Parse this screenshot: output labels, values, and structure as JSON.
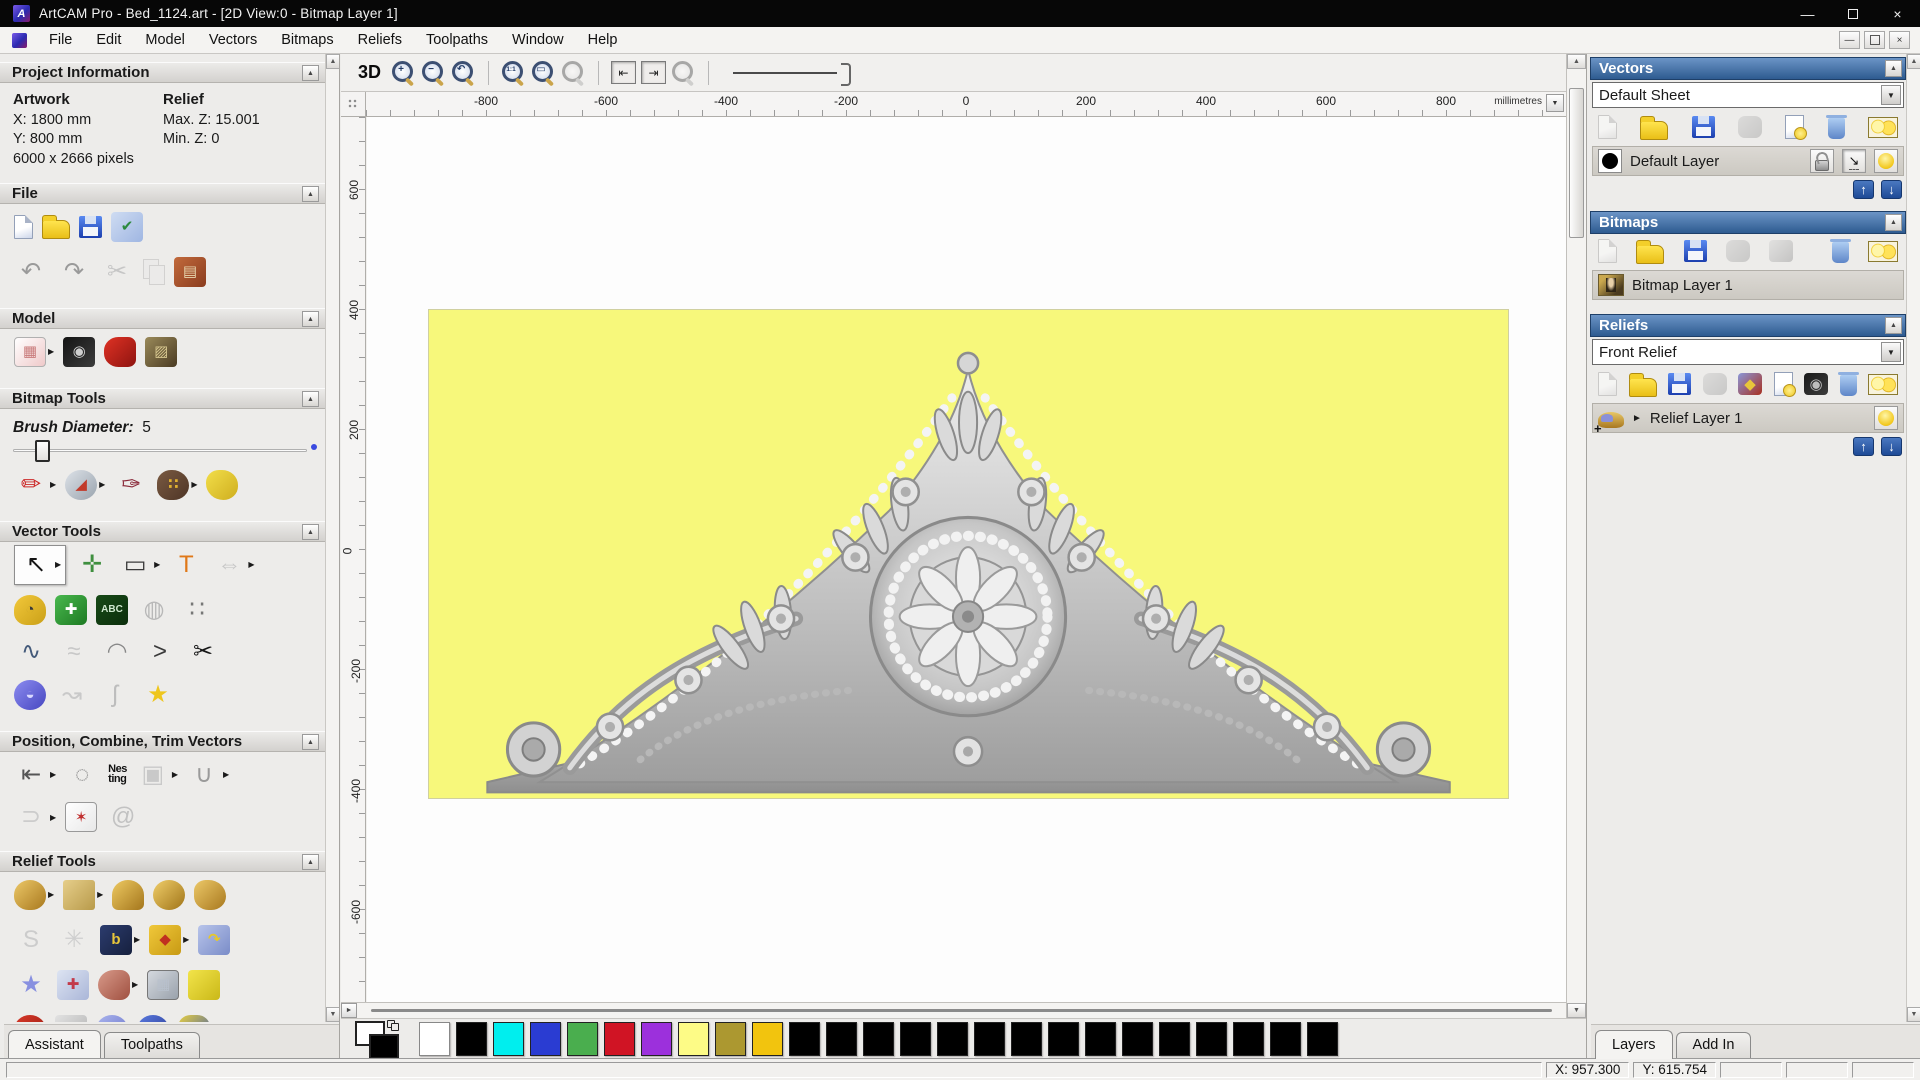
{
  "window": {
    "title": "ArtCAM Pro - Bed_1124.art - [2D View:0 - Bitmap Layer 1]",
    "app_initial": "A",
    "minimize_glyph": "—",
    "close_glyph": "×"
  },
  "menu": {
    "items": [
      "File",
      "Edit",
      "Model",
      "Vectors",
      "Bitmaps",
      "Reliefs",
      "Toolpaths",
      "Window",
      "Help"
    ]
  },
  "left_panel": {
    "project_information": {
      "title": "Project Information",
      "artwork_label": "Artwork",
      "artwork_x": "X: 1800 mm",
      "artwork_y": "Y: 800 mm",
      "artwork_pixels": "6000 x 2666 pixels",
      "relief_label": "Relief",
      "relief_max_z": "Max. Z: 15.001",
      "relief_min_z": "Min. Z: 0"
    },
    "file_section": {
      "title": "File",
      "row1": [
        {
          "name": "new-model-icon",
          "type": "page"
        },
        {
          "name": "open-model-icon",
          "type": "folder"
        },
        {
          "name": "save-model-icon",
          "type": "floppy"
        },
        {
          "name": "model-properties-icon",
          "type": "tile",
          "bg": "#cfdcf2",
          "bg2": "#9fb6e2",
          "glyph": "✔",
          "fg": "#2d8a3e"
        }
      ],
      "row2": [
        {
          "name": "undo-icon",
          "type": "glyph",
          "glyph": "↶",
          "fg": "#9a9a9a"
        },
        {
          "name": "redo-icon",
          "type": "glyph",
          "glyph": "↷",
          "fg": "#9a9a9a"
        },
        {
          "name": "cut-icon",
          "type": "glyph",
          "glyph": "✂",
          "fg": "#c6c6c6"
        },
        {
          "name": "copy-icon",
          "type": "copy",
          "grayed": true
        },
        {
          "name": "paste-icon",
          "type": "tile",
          "bg": "#c26a3c",
          "bg2": "#8a3c1e",
          "glyph": "▤",
          "fg": "#e8d8b0"
        }
      ]
    },
    "model_section": {
      "title": "Model",
      "row": [
        {
          "name": "set-model-size-icon",
          "type": "tile",
          "bg": "#ffffff",
          "bg2": "#efc9c9",
          "glyph": "▦",
          "fg": "#c97a7a",
          "border": "#b0b0b0",
          "arrow": true
        },
        {
          "name": "adjust-model-icon",
          "type": "tile",
          "bg": "#141414",
          "bg2": "#3c3c3c",
          "glyph": "◉",
          "fg": "#cfcfcf"
        },
        {
          "name": "model-lighting-icon",
          "type": "tile",
          "bg": "#e03224",
          "bg2": "#8e1410",
          "radius": "45% 25% 25% 45%"
        },
        {
          "name": "bitmap-to-vector-icon",
          "type": "tile",
          "bg": "#9a8a5a",
          "bg2": "#4a3a22",
          "glyph": "▨",
          "fg": "#d8c890"
        }
      ]
    },
    "bitmap_tools": {
      "title": "Bitmap Tools",
      "brush_label": "Brush Diameter:",
      "brush_value": "5",
      "row": [
        {
          "name": "paint-icon",
          "type": "glyph",
          "glyph": "✏",
          "fg": "#cc2a2a",
          "arrow": true
        },
        {
          "name": "flood-fill-icon",
          "type": "tile",
          "bg": "#dde2e8",
          "bg2": "#9aa4ae",
          "glyph": "◢",
          "fg": "#c23a2a",
          "radius": "50%",
          "arrow": true
        },
        {
          "name": "colour-picker-icon",
          "type": "glyph",
          "glyph": "✑",
          "fg": "#8a2a3a"
        },
        {
          "name": "paint-palette-icon",
          "type": "tile",
          "bg": "#7a5a42",
          "bg2": "#4e3526",
          "radius": "50% 60% 55% 45%",
          "glyph": "∷",
          "fg": "#e0b030",
          "arrow": true
        },
        {
          "name": "flood-fill-tolerance-icon",
          "type": "tile",
          "bg": "#f2de4a",
          "bg2": "#cfae1e",
          "radius": "45% 55% 50% 60%"
        }
      ]
    },
    "vector_tools": {
      "title": "Vector Tools",
      "rows": [
        [
          {
            "name": "select-vectors-icon",
            "type": "glyph",
            "glyph": "↖",
            "fg": "#141414",
            "pressed": true,
            "arrow": true
          },
          {
            "name": "transform-vectors-icon",
            "type": "glyph",
            "glyph": "✛",
            "fg": "#3f8f3f"
          },
          {
            "name": "create-rectangle-icon",
            "type": "glyph",
            "glyph": "▭",
            "fg": "#3a3a3a",
            "arrow": true
          },
          {
            "name": "create-text-icon",
            "type": "glyph",
            "glyph": "T",
            "fg": "#e07818"
          },
          {
            "name": "mirror-vectors-icon",
            "type": "glyph",
            "glyph": "⇔",
            "fg": "#c6c6c6",
            "arrow": true
          }
        ],
        [
          {
            "name": "measure-icon",
            "type": "tile",
            "bg": "#f2c83a",
            "bg2": "#caa018",
            "radius": "50% 50% 40% 40%",
            "glyph": "◔",
            "fg": "#3a3a3a"
          },
          {
            "name": "create-polyline-icon",
            "type": "tile",
            "bg": "#49b84e",
            "bg2": "#1d7a22",
            "glyph": "✚",
            "fg": "#ffffff",
            "radius": "6px"
          },
          {
            "name": "vector-library-icon",
            "type": "tile",
            "bg": "#174a17",
            "bg2": "#0c2e0c",
            "glyph": "ABC",
            "fg": "#cfe8cf",
            "small": true
          },
          {
            "name": "vector-wrap-grid-icon",
            "type": "glyph",
            "glyph": "◍",
            "fg": "#b8b8b8"
          },
          {
            "name": "paste-array-icon",
            "type": "glyph",
            "glyph": "∷",
            "fg": "#777777"
          }
        ],
        [
          {
            "name": "node-editing-icon",
            "type": "glyph",
            "glyph": "∿",
            "fg": "#445a7a"
          },
          {
            "name": "free-sketch-icon",
            "type": "glyph",
            "glyph": "≈",
            "fg": "#c8c8c8"
          },
          {
            "name": "arc-editing-icon",
            "type": "glyph",
            "glyph": "◠",
            "fg": "#888888"
          },
          {
            "name": "polyline-angle-icon",
            "type": "glyph",
            "glyph": ">",
            "fg": "#3a3a3a"
          },
          {
            "name": "cut-vector-icon",
            "type": "glyph",
            "glyph": "✂",
            "fg": "#161616"
          }
        ],
        [
          {
            "name": "offset-vector-icon",
            "type": "tile",
            "bg": "#8c8cf0",
            "bg2": "#4646c0",
            "radius": "50%",
            "glyph": "◒",
            "fg": "#d8d8ff"
          },
          {
            "name": "fit-arcs-icon",
            "type": "glyph",
            "glyph": "↝",
            "fg": "#c9c9c9"
          },
          {
            "name": "trace-boundary-icon",
            "type": "glyph",
            "glyph": "ʃ",
            "fg": "#bdbdbd"
          },
          {
            "name": "create-star-icon",
            "type": "glyph",
            "glyph": "★",
            "fg": "#eec61e"
          }
        ]
      ]
    },
    "position_tools": {
      "title": "Position, Combine, Trim Vectors",
      "rows": [
        [
          {
            "name": "align-vectors-icon",
            "type": "glyph",
            "glyph": "⇤",
            "fg": "#555555",
            "arrow": true
          },
          {
            "name": "text-on-curve-icon",
            "type": "glyph",
            "glyph": "◌",
            "fg": "#888888"
          },
          {
            "name": "nesting-icon",
            "type": "nesting",
            "glyph": "Nes\nting",
            "fg": "#111111"
          },
          {
            "name": "group-vectors-icon",
            "type": "glyph",
            "glyph": "▣",
            "fg": "#c9c9c9",
            "arrow": true
          },
          {
            "name": "weld-vectors-icon",
            "type": "glyph",
            "glyph": "∪",
            "fg": "#9a9a9a",
            "arrow": true
          }
        ],
        [
          {
            "name": "join-vectors-icon",
            "type": "glyph",
            "glyph": "⊃",
            "fg": "#cccccc",
            "arrow": true
          },
          {
            "name": "vector-texture-icon",
            "type": "tile",
            "bg": "#ffffff",
            "bg2": "#e8e8e8",
            "glyph": "✶",
            "fg": "#c03030",
            "border": "#999999"
          },
          {
            "name": "spiral-icon",
            "type": "glyph",
            "glyph": "@",
            "fg": "#c2c2c2"
          }
        ]
      ]
    },
    "relief_tools": {
      "title": "Relief Tools",
      "rows": [
        [
          {
            "name": "relief-editing-icon",
            "type": "tile",
            "bg": "#ecc868",
            "bg2": "#a8781e",
            "radius": "50% 50% 45% 45%",
            "arrow": true
          },
          {
            "name": "shape-editor-icon",
            "type": "tile",
            "bg": "#e6ce8a",
            "bg2": "#b89a4a",
            "radius": "3px",
            "arrow": true
          },
          {
            "name": "smooth-relief-icon",
            "type": "tile",
            "bg": "#eeca62",
            "bg2": "#a4761c",
            "radius": "50% 50% 20% 20%"
          },
          {
            "name": "relief-dome-icon",
            "type": "tile",
            "bg": "#f0ce6a",
            "bg2": "#a07418",
            "radius": "50%"
          },
          {
            "name": "relief-hands-icon",
            "type": "tile",
            "bg": "#ecc868",
            "bg2": "#a8781e",
            "radius": "40% 60% 50% 50%"
          }
        ],
        [
          {
            "name": "sculpting-icon",
            "type": "glyph",
            "glyph": "S",
            "fg": "#cccccc"
          },
          {
            "name": "weave-wizard-icon",
            "type": "glyph",
            "glyph": "✳",
            "fg": "#cfcfcf"
          },
          {
            "name": "relief-from-bitmap-icon",
            "type": "tile",
            "bg": "#2c3c6e",
            "bg2": "#16203e",
            "glyph": "b",
            "fg": "#e8c63a",
            "arrow": true
          },
          {
            "name": "relief-layer-stack-icon",
            "type": "tile",
            "bg": "#f0c83a",
            "bg2": "#c89a14",
            "glyph": "◆",
            "fg": "#c03020",
            "arrow": true
          },
          {
            "name": "wrap-relief-icon",
            "type": "tile",
            "bg": "#b8c4ea",
            "bg2": "#7a8cc8",
            "glyph": "↷",
            "fg": "#e8c828"
          }
        ],
        [
          {
            "name": "star-relief-icon",
            "type": "glyph",
            "glyph": "★",
            "fg": "#8890e0"
          },
          {
            "name": "texture-wrap-icon",
            "type": "tile",
            "bg": "#dde4f2",
            "bg2": "#aab6d8",
            "glyph": "✚",
            "fg": "#c23a4a"
          },
          {
            "name": "two-rail-sweep-icon",
            "type": "tile",
            "bg": "#d89a8a",
            "bg2": "#a05040",
            "radius": "50% 30% 30% 50%",
            "arrow": true
          },
          {
            "name": "emboss-relief-icon",
            "type": "tile",
            "bg": "#d4d8de",
            "bg2": "#9aa2ac",
            "glyph": "▦",
            "fg": "#b8c0cc",
            "border": "#777777"
          },
          {
            "name": "offset-relief-icon",
            "type": "tile",
            "bg": "#f2e44a",
            "bg2": "#cab818"
          }
        ],
        [
          {
            "name": "turn-model-icon",
            "type": "tile",
            "bg": "#d83a2a",
            "bg2": "#981a10",
            "radius": "50% 50% 30% 30%"
          },
          {
            "name": "basket-weave-icon",
            "type": "tile",
            "bg": "#e2e2e2",
            "bg2": "#b0b0b0",
            "glyph": "▦",
            "fg": "#8a8a8a"
          },
          {
            "name": "dome-relief-icon",
            "type": "tile",
            "bg": "#aab4ee",
            "bg2": "#6a74c8",
            "radius": "50% 50% 20% 20%"
          },
          {
            "name": "texture-sphere-icon",
            "type": "tile",
            "bg": "#5a7ae0",
            "bg2": "#2a3a90",
            "radius": "50%",
            "glyph": "✻",
            "fg": "#9ab0f0"
          },
          {
            "name": "extrude-icon",
            "type": "tile",
            "bg": "#e8d040",
            "bg2": "#3a58b0",
            "radius": "40%"
          }
        ]
      ]
    },
    "tabs": [
      {
        "label": "Assistant",
        "active": true
      },
      {
        "label": "Toolpaths",
        "active": false
      }
    ]
  },
  "toolbar": {
    "items": [
      {
        "name": "view-3d-button",
        "type": "text3d",
        "label": "3D"
      },
      {
        "name": "zoom-in-icon",
        "type": "mag",
        "glyph": "+"
      },
      {
        "name": "zoom-out-icon",
        "type": "mag",
        "glyph": "−"
      },
      {
        "name": "zoom-previous-icon",
        "type": "mag",
        "glyph": "↶"
      },
      {
        "type": "sep"
      },
      {
        "name": "zoom-1to1-icon",
        "type": "mag",
        "glyph": "1:1",
        "small": true
      },
      {
        "name": "zoom-fit-icon",
        "type": "mag",
        "glyph": "▭"
      },
      {
        "name": "zoom-object-icon",
        "type": "mag",
        "glyph": "",
        "grayed": true
      },
      {
        "type": "sep"
      },
      {
        "name": "snap-left-toggle",
        "type": "boxbtn",
        "glyph": "⇤"
      },
      {
        "name": "snap-right-toggle",
        "type": "boxbtn",
        "glyph": "⇥"
      },
      {
        "name": "preview-zoom-icon",
        "type": "mag",
        "glyph": "",
        "grayed": true
      },
      {
        "type": "sep"
      },
      {
        "name": "zoom-slider",
        "type": "zslider"
      }
    ]
  },
  "rulers": {
    "unit_label": "millimetres",
    "top": [
      {
        "t": "-800",
        "p": 10
      },
      {
        "t": "-600",
        "p": 20
      },
      {
        "t": "-400",
        "p": 30
      },
      {
        "t": "-200",
        "p": 40
      },
      {
        "t": "0",
        "p": 50
      },
      {
        "t": "200",
        "p": 60
      },
      {
        "t": "400",
        "p": 70
      },
      {
        "t": "600",
        "p": 80
      },
      {
        "t": "800",
        "p": 90
      }
    ],
    "left": [
      {
        "t": "600",
        "p": 7.5
      },
      {
        "t": "400",
        "p": 21
      },
      {
        "t": "200",
        "p": 34.6
      },
      {
        "t": "0",
        "p": 48.2
      },
      {
        "t": "-200",
        "p": 61.8
      },
      {
        "t": "-400",
        "p": 75.4
      },
      {
        "t": "-600",
        "p": 89
      }
    ]
  },
  "canvas": {
    "artwork_background": "#f7f87b"
  },
  "right_panel": {
    "vectors": {
      "title": "Vectors",
      "sheet_combo_value": "Default Sheet",
      "tools": [
        {
          "name": "new-vector-layer-icon",
          "type": "page",
          "grayed": true
        },
        {
          "name": "open-vector-layer-icon",
          "type": "folder"
        },
        {
          "name": "save-vector-layer-icon",
          "type": "floppy"
        },
        {
          "name": "merge-vector-layers-icon",
          "type": "tile",
          "bg": "#d8c4a4",
          "bg2": "#b09a78",
          "grayed": true,
          "radius": "30%"
        },
        {
          "name": "new-sheet-icon",
          "type": "pagebulb"
        },
        {
          "name": "delete-vector-layer-icon",
          "type": "trash"
        },
        {
          "name": "toggle-all-vectors-icon",
          "type": "bulbs",
          "boxed": true
        }
      ],
      "layer_name": "Default Layer"
    },
    "bitmaps": {
      "title": "Bitmaps",
      "tools": [
        {
          "name": "new-bitmap-layer-icon",
          "type": "page",
          "grayed": true
        },
        {
          "name": "open-bitmap-layer-icon",
          "type": "folder"
        },
        {
          "name": "save-bitmap-layer-icon",
          "type": "floppy"
        },
        {
          "name": "merge-bitmap-layers-icon",
          "type": "tile",
          "bg": "#d8c4a4",
          "bg2": "#b09a78",
          "grayed": true,
          "radius": "30%"
        },
        {
          "name": "blank-bitmap-icon",
          "type": "tile",
          "bg": "#cfd3d8",
          "bg2": "#8e9298",
          "grayed": true
        },
        {
          "name": "bitmap-preview-icon",
          "type": "mona"
        },
        {
          "name": "delete-bitmap-layer-icon",
          "type": "trash"
        },
        {
          "name": "toggle-all-bitmaps-icon",
          "type": "bulbs",
          "boxed": true
        }
      ],
      "layer_name": "Bitmap Layer 1"
    },
    "reliefs": {
      "title": "Reliefs",
      "relief_combo_value": "Front Relief",
      "tools": [
        {
          "name": "new-relief-layer-icon",
          "type": "page",
          "grayed": true
        },
        {
          "name": "open-relief-layer-icon",
          "type": "folder"
        },
        {
          "name": "save-relief-layer-icon",
          "type": "floppy"
        },
        {
          "name": "merge-relief-layers-icon",
          "type": "tile",
          "bg": "#d8c4a4",
          "bg2": "#b09a78",
          "grayed": true,
          "radius": "30%"
        },
        {
          "name": "relief-stack-icon",
          "type": "tile",
          "bg": "#8a96d8",
          "bg2": "#a83020",
          "glyph": "◆",
          "fg": "#e8c63a"
        },
        {
          "name": "relief-sheet-icon",
          "type": "pagebulb"
        },
        {
          "name": "relief-preview-icon",
          "type": "tile",
          "bg": "#1a1a1a",
          "bg2": "#3c3c3c",
          "glyph": "◉",
          "fg": "#bdbdbd"
        },
        {
          "name": "delete-relief-layer-icon",
          "type": "trash"
        },
        {
          "name": "toggle-all-reliefs-icon",
          "type": "bulbs",
          "boxed": true
        }
      ],
      "layer_name": "Relief Layer 1"
    },
    "tabs": [
      {
        "label": "Layers",
        "active": true
      },
      {
        "label": "Add In",
        "active": false
      }
    ]
  },
  "palette": {
    "primary": "#ffffff",
    "secondary": "#000000",
    "swatches": [
      "#ffffff",
      "#000000",
      "#00eeee",
      "#2a3cd2",
      "#4aae4e",
      "#d01424",
      "#9c30dc",
      "#fdfb86",
      "#ac9830",
      "#f2c40e",
      "#000000",
      "#000000",
      "#000000",
      "#000000",
      "#000000",
      "#000000",
      "#000000",
      "#000000",
      "#000000",
      "#000000",
      "#000000",
      "#000000",
      "#000000",
      "#000000",
      "#000000"
    ]
  },
  "status_bar": {
    "cells": [
      "X: 957.300",
      "Y: 615.754",
      "",
      "",
      ""
    ]
  }
}
